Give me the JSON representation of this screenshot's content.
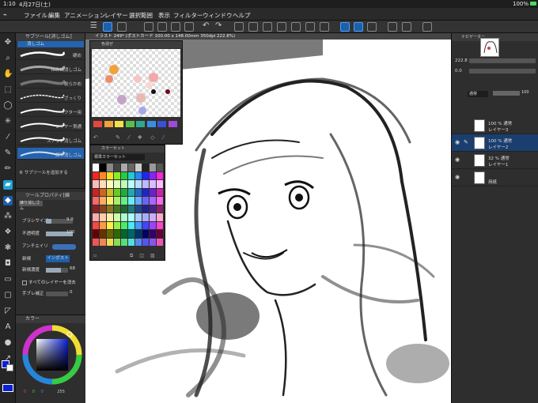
{
  "status": {
    "time": "1:10",
    "date": "4月27日(土)",
    "battery": "100%"
  },
  "menu": [
    "ファイル",
    "編集",
    "アニメーション",
    "レイヤー",
    "選択範囲",
    "表示",
    "フィルター",
    "ウィンドウ",
    "ヘルプ"
  ],
  "subtool": {
    "title": "サブツール[消しゴム]",
    "group": "消しゴム",
    "items": [
      "硬め",
      "ほみ出消しゴム",
      "軟らかめ",
      "ざっくり",
      "ベクター用",
      "レイヤー貫通",
      "スナップ消しゴム",
      "練り消しゴム"
    ],
    "add_label": "サブツールを追加する"
  },
  "tool_property": {
    "title": "ツールプロパティ[練",
    "tool_name": "練り消しゴム",
    "brush_size_label": "ブラシサイズ",
    "brush_size_value": "9.0",
    "opacity_label": "不透明度",
    "opacity_value": "100",
    "antialias_label": "アンチエイリ",
    "hardness_label": "新規",
    "import_label": "インポスト",
    "density_label": "新規濃度",
    "density_value": "68",
    "all_layers_label": "すべてのレイヤーを消去",
    "stabilizer_label": "手ブレ補正",
    "stabilizer_value": "0"
  },
  "color_panel": {
    "title": "カラー",
    "values": [
      "0",
      "0",
      "0"
    ],
    "value_max": "255"
  },
  "doc_tab": "イラスト 249* (ポストカード 100.00 x 148.00mm 350dpi 222.8%)",
  "palette_float": {
    "title": "色混ぜ",
    "swatches": [
      "#e8463c",
      "#f0a23a",
      "#f4e04b",
      "#58c04a",
      "#2fa88e",
      "#3a8ee0",
      "#3b4fd8",
      "#a04ad8"
    ]
  },
  "colorset_float": {
    "title": "カラーセット",
    "set_name": "標準カラーセット"
  },
  "navigator": {
    "title": "ナビゲーター",
    "zoom": "222.8",
    "angle": "0.0"
  },
  "layer_panel": {
    "blend_mode": "通常",
    "opacity": "100",
    "layers": [
      {
        "name": "レイヤー3",
        "info": "100 % 通常"
      },
      {
        "name": "レイヤー2",
        "info": "100 % 通常"
      },
      {
        "name": "レイヤー1",
        "info": "32 % 通常"
      },
      {
        "name": "用紙",
        "info": ""
      }
    ]
  },
  "colors": {
    "accent": "#1e5fa8",
    "fg_color": "#0a1fd8",
    "bg_color": "#ffffff"
  }
}
